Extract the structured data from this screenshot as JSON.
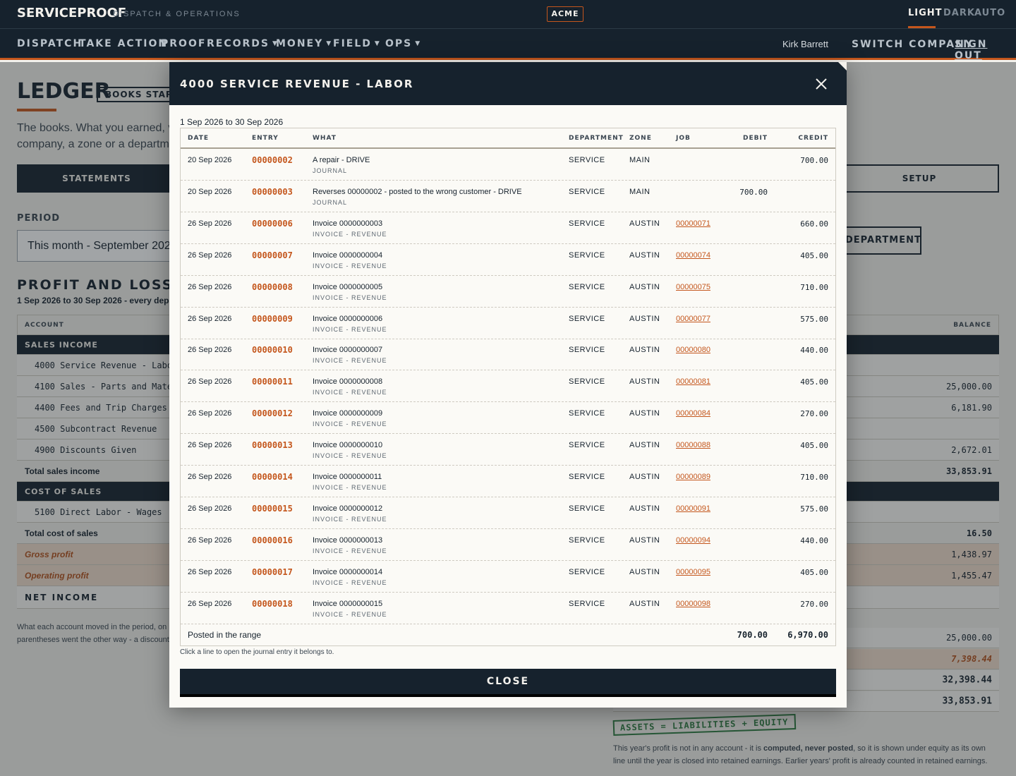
{
  "brand": {
    "name": "SERVICEPROOF",
    "tagline": "DISPATCH & OPERATIONS",
    "company_badge": "ACME"
  },
  "theme": {
    "options": [
      "LIGHT",
      "DARK",
      "AUTO"
    ],
    "active": "LIGHT"
  },
  "nav": {
    "items": [
      {
        "label": "DISPATCH",
        "dropdown": false
      },
      {
        "label": "TAKE ACTION",
        "dropdown": false
      },
      {
        "label": "PROOF",
        "dropdown": false
      },
      {
        "label": "RECORDS",
        "dropdown": true
      },
      {
        "label": "MONEY",
        "dropdown": true
      },
      {
        "label": "FIELD",
        "dropdown": true
      },
      {
        "label": "OPS",
        "dropdown": true
      }
    ],
    "user": "Kirk Barrett",
    "switch_company": "SWITCH COMPANY",
    "sign_out": "SIGN OUT"
  },
  "page": {
    "title": "LEDGER",
    "books_start_badge": "BOOKS START",
    "description_1": "The books. What you earned, v",
    "description_2": "company, a zone or a departm",
    "tab_statements": "STATEMENTS",
    "tab_setup": "SETUP",
    "period_label": "PERIOD",
    "period_value": "This month - September 2026",
    "by_department_button": "Y DEPARTMENT",
    "pl_title": "PROFIT AND LOSS",
    "pl_subtitle": "1 Sep 2026 to 30 Sep 2026 - every departr",
    "pl_col_account": "ACCOUNT",
    "pl_col_balance": "BALANCE",
    "pl_rows": [
      {
        "type": "section",
        "name": "SALES INCOME",
        "value": ""
      },
      {
        "type": "acct",
        "name": "4000 Service Revenue - Labor",
        "value": ""
      },
      {
        "type": "acct",
        "name": "4100 Sales - Parts and Materials",
        "value": "25,000.00"
      },
      {
        "type": "acct",
        "name": "4400 Fees and Trip Charges",
        "value": "6,181.90"
      },
      {
        "type": "acct",
        "name": "4500 Subcontract Revenue",
        "value": ""
      },
      {
        "type": "acct",
        "name": "4900 Discounts Given",
        "value": "2,672.01"
      },
      {
        "type": "total",
        "name": "Total sales income",
        "value": "33,853.91"
      },
      {
        "type": "section",
        "name": "COST OF SALES",
        "value": ""
      },
      {
        "type": "acct",
        "name": "5100 Direct Labor - Wages",
        "value": ""
      },
      {
        "type": "total",
        "name": "Total cost of sales",
        "value": "16.50"
      },
      {
        "type": "highlight",
        "name": "Gross profit",
        "value": "1,438.97"
      },
      {
        "type": "highlight",
        "name": "Operating profit",
        "value": "1,455.47"
      },
      {
        "type": "net",
        "name": "NET INCOME",
        "value": ""
      }
    ],
    "pl_footnote_1": "What each account moved in the period, on its",
    "pl_footnote_2": "parentheses went the other way - a discount i",
    "bs_rows": [
      {
        "type": "plain",
        "value": "25,000.00"
      },
      {
        "type": "hl",
        "value": "7,398.44"
      },
      {
        "type": "tot",
        "value": "32,398.44"
      },
      {
        "type": "tot",
        "value": "33,853.91"
      }
    ],
    "stamp": "ASSETS = LIABILITIES + EQUITY",
    "bs_note_1": "This year's profit is not in any account - it is ",
    "bs_note_bold": "computed, never posted",
    "bs_note_2": ", so it is shown under equity as its own line until the year is closed into retained earnings. Earlier years' profit is already counted in retained earnings."
  },
  "modal": {
    "title": "4000 SERVICE REVENUE - LABOR",
    "range": "1 Sep 2026 to 30 Sep 2026",
    "columns": {
      "date": "DATE",
      "entry": "ENTRY",
      "what": "WHAT",
      "department": "DEPARTMENT",
      "zone": "ZONE",
      "job": "JOB",
      "debit": "DEBIT",
      "credit": "CREDIT"
    },
    "rows": [
      {
        "date": "20 Sep 2026",
        "entry": "00000002",
        "what": "A repair - DRIVE",
        "kind": "JOURNAL",
        "department": "SERVICE",
        "zone": "MAIN",
        "job": "",
        "debit": "",
        "credit": "700.00"
      },
      {
        "date": "20 Sep 2026",
        "entry": "00000003",
        "what": "Reverses 00000002 - posted to the wrong customer - DRIVE",
        "kind": "JOURNAL",
        "department": "SERVICE",
        "zone": "MAIN",
        "job": "",
        "debit": "700.00",
        "credit": ""
      },
      {
        "date": "26 Sep 2026",
        "entry": "00000006",
        "what": "Invoice 0000000003",
        "kind": "INVOICE - REVENUE",
        "department": "SERVICE",
        "zone": "AUSTIN",
        "job": "00000071",
        "debit": "",
        "credit": "660.00"
      },
      {
        "date": "26 Sep 2026",
        "entry": "00000007",
        "what": "Invoice 0000000004",
        "kind": "INVOICE - REVENUE",
        "department": "SERVICE",
        "zone": "AUSTIN",
        "job": "00000074",
        "debit": "",
        "credit": "405.00"
      },
      {
        "date": "26 Sep 2026",
        "entry": "00000008",
        "what": "Invoice 0000000005",
        "kind": "INVOICE - REVENUE",
        "department": "SERVICE",
        "zone": "AUSTIN",
        "job": "00000075",
        "debit": "",
        "credit": "710.00"
      },
      {
        "date": "26 Sep 2026",
        "entry": "00000009",
        "what": "Invoice 0000000006",
        "kind": "INVOICE - REVENUE",
        "department": "SERVICE",
        "zone": "AUSTIN",
        "job": "00000077",
        "debit": "",
        "credit": "575.00"
      },
      {
        "date": "26 Sep 2026",
        "entry": "00000010",
        "what": "Invoice 0000000007",
        "kind": "INVOICE - REVENUE",
        "department": "SERVICE",
        "zone": "AUSTIN",
        "job": "00000080",
        "debit": "",
        "credit": "440.00"
      },
      {
        "date": "26 Sep 2026",
        "entry": "00000011",
        "what": "Invoice 0000000008",
        "kind": "INVOICE - REVENUE",
        "department": "SERVICE",
        "zone": "AUSTIN",
        "job": "00000081",
        "debit": "",
        "credit": "405.00"
      },
      {
        "date": "26 Sep 2026",
        "entry": "00000012",
        "what": "Invoice 0000000009",
        "kind": "INVOICE - REVENUE",
        "department": "SERVICE",
        "zone": "AUSTIN",
        "job": "00000084",
        "debit": "",
        "credit": "270.00"
      },
      {
        "date": "26 Sep 2026",
        "entry": "00000013",
        "what": "Invoice 0000000010",
        "kind": "INVOICE - REVENUE",
        "department": "SERVICE",
        "zone": "AUSTIN",
        "job": "00000088",
        "debit": "",
        "credit": "405.00"
      },
      {
        "date": "26 Sep 2026",
        "entry": "00000014",
        "what": "Invoice 0000000011",
        "kind": "INVOICE - REVENUE",
        "department": "SERVICE",
        "zone": "AUSTIN",
        "job": "00000089",
        "debit": "",
        "credit": "710.00"
      },
      {
        "date": "26 Sep 2026",
        "entry": "00000015",
        "what": "Invoice 0000000012",
        "kind": "INVOICE - REVENUE",
        "department": "SERVICE",
        "zone": "AUSTIN",
        "job": "00000091",
        "debit": "",
        "credit": "575.00"
      },
      {
        "date": "26 Sep 2026",
        "entry": "00000016",
        "what": "Invoice 0000000013",
        "kind": "INVOICE - REVENUE",
        "department": "SERVICE",
        "zone": "AUSTIN",
        "job": "00000094",
        "debit": "",
        "credit": "440.00"
      },
      {
        "date": "26 Sep 2026",
        "entry": "00000017",
        "what": "Invoice 0000000014",
        "kind": "INVOICE - REVENUE",
        "department": "SERVICE",
        "zone": "AUSTIN",
        "job": "00000095",
        "debit": "",
        "credit": "405.00"
      },
      {
        "date": "26 Sep 2026",
        "entry": "00000018",
        "what": "Invoice 0000000015",
        "kind": "INVOICE - REVENUE",
        "department": "SERVICE",
        "zone": "AUSTIN",
        "job": "00000098",
        "debit": "",
        "credit": "270.00"
      }
    ],
    "footer_label": "Posted in the range",
    "footer_debit": "700.00",
    "footer_credit": "6,970.00",
    "hint": "Click a line to open the journal entry it belongs to.",
    "close_label": "CLOSE"
  }
}
